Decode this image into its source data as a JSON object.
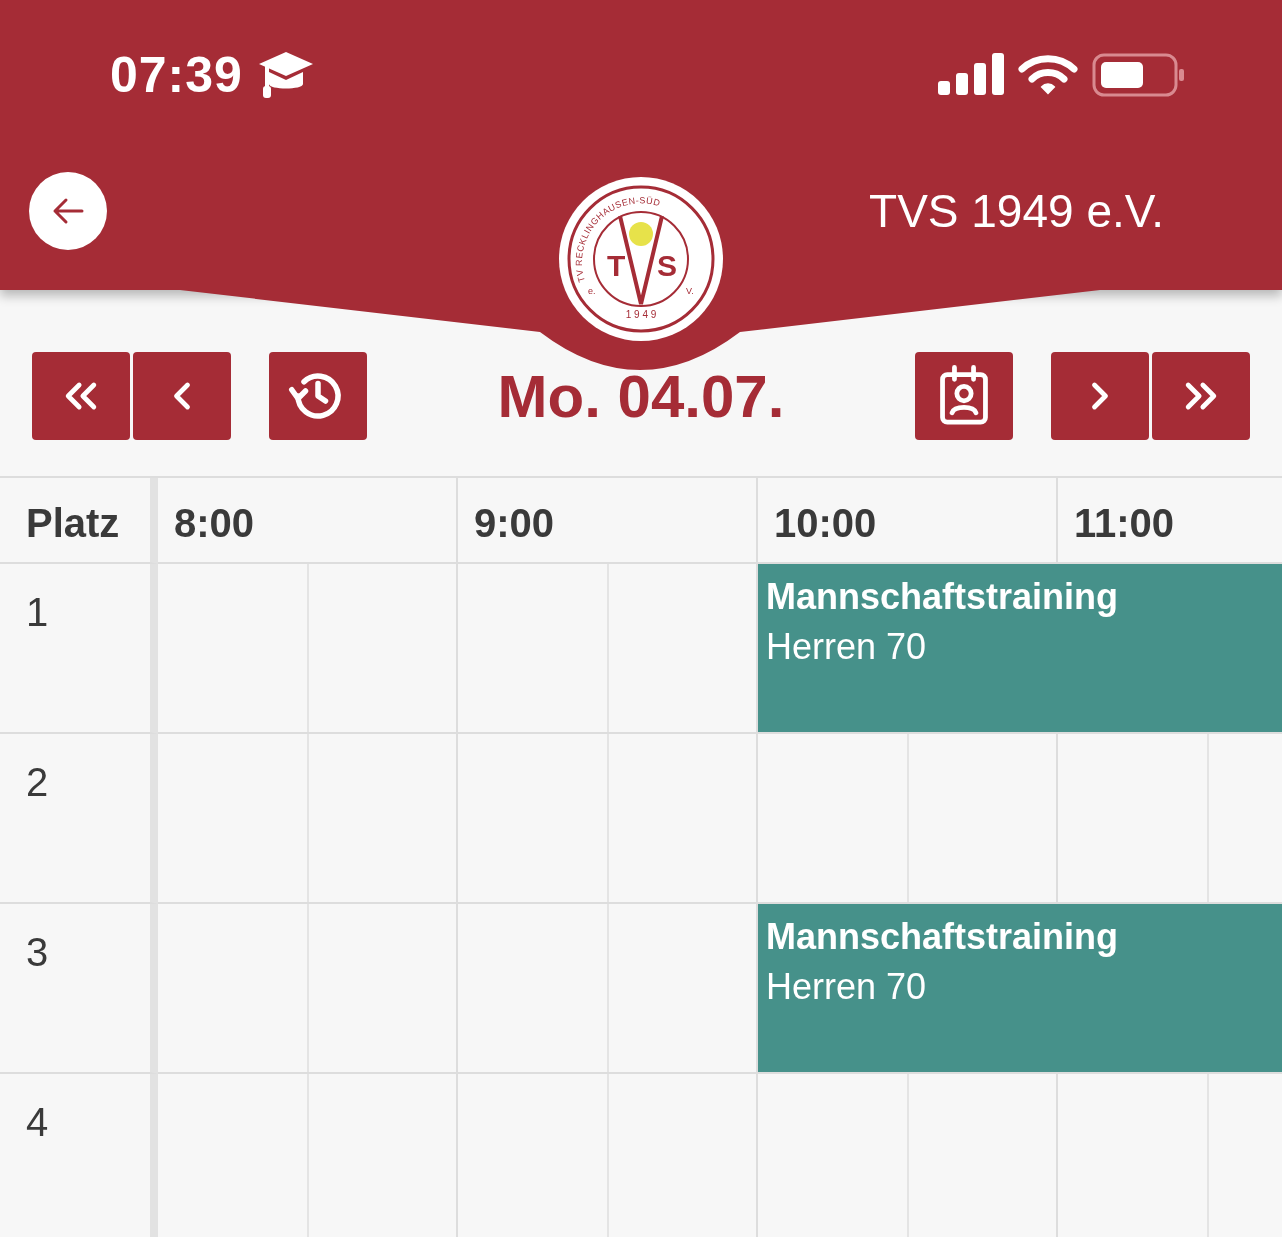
{
  "status_bar": {
    "time": "07:39"
  },
  "header": {
    "title": "TVS 1949 e.V.",
    "logo": {
      "ring_text": "TV RECKLINGHAUSEN-SÜD",
      "left_letter": "T",
      "right_letter": "S",
      "left_mark": "e.",
      "right_mark": "V.",
      "year": "1 9 4 9"
    }
  },
  "nav": {
    "date": "Mo. 04.07."
  },
  "grid": {
    "corner": "Platz",
    "hours": [
      "8:00",
      "9:00",
      "10:00",
      "11:00"
    ],
    "courts": [
      {
        "label": "1",
        "slots": [
          {
            "kind": "free"
          },
          {
            "kind": "free"
          },
          {
            "kind": "booking",
            "title": "Mannschaftstraining",
            "subtitle": "Herren 70"
          },
          {
            "kind": "continued"
          }
        ]
      },
      {
        "label": "2",
        "slots": [
          {
            "kind": "free"
          },
          {
            "kind": "free"
          },
          {
            "kind": "free"
          },
          {
            "kind": "free"
          }
        ]
      },
      {
        "label": "3",
        "slots": [
          {
            "kind": "free"
          },
          {
            "kind": "free"
          },
          {
            "kind": "booking",
            "title": "Mannschaftstraining",
            "subtitle": "Herren 70"
          },
          {
            "kind": "continued"
          }
        ]
      },
      {
        "label": "4",
        "slots": [
          {
            "kind": "free"
          },
          {
            "kind": "free"
          },
          {
            "kind": "free"
          },
          {
            "kind": "free"
          }
        ]
      }
    ]
  }
}
